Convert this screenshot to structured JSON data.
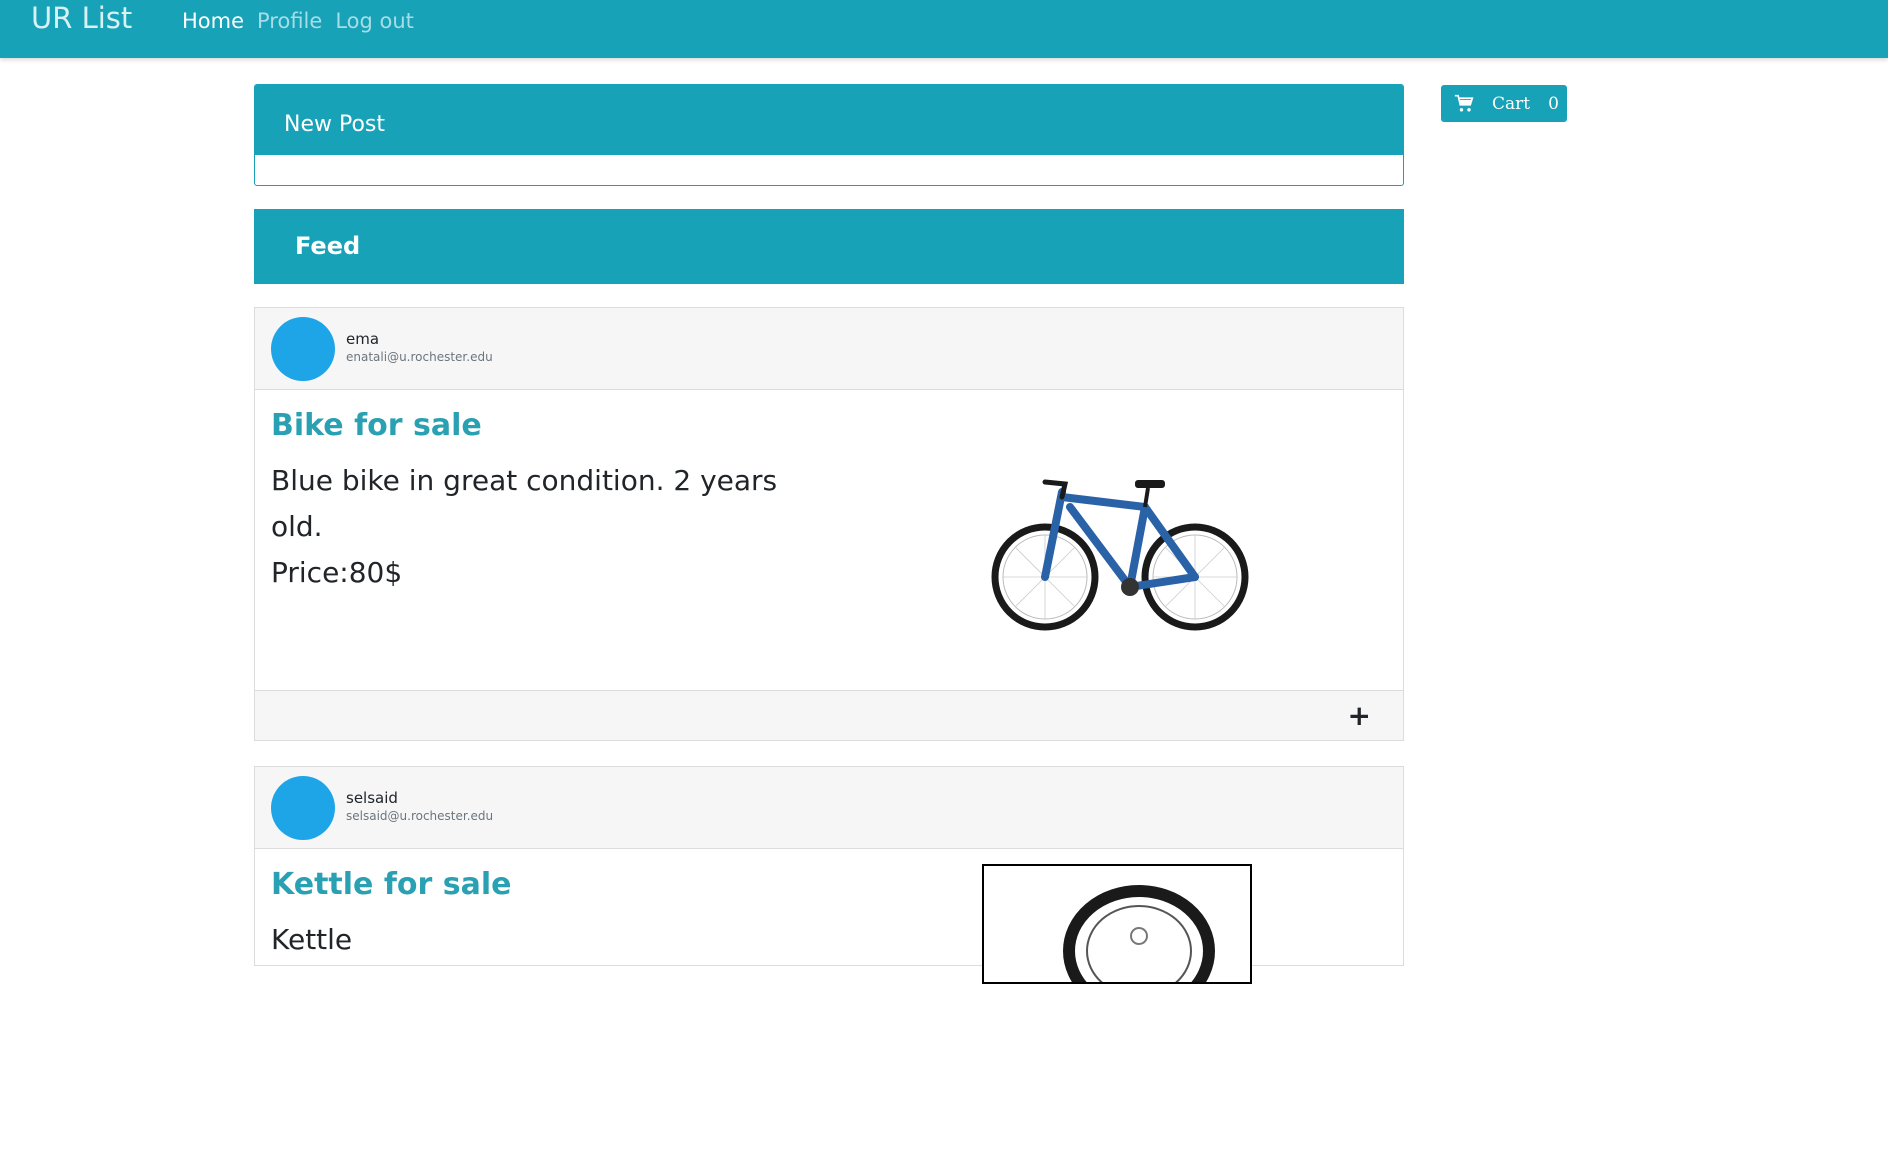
{
  "navbar": {
    "brand": "UR List",
    "links": [
      "Home",
      "Profile",
      "Log out"
    ]
  },
  "cart": {
    "label": "Cart",
    "count": "0"
  },
  "new_post": {
    "title": "New Post"
  },
  "feed": {
    "title": "Feed"
  },
  "posts": [
    {
      "username": "ema",
      "email": "enatali@u.rochester.edu",
      "title": "Bike for sale",
      "description": "Blue bike in great condition. 2 years old.",
      "price": "Price:80$",
      "image_icon": "bicycle",
      "action": "+"
    },
    {
      "username": "selsaid",
      "email": "selsaid@u.rochester.edu",
      "title": "Kettle for sale",
      "description": "Kettle",
      "image_icon": "kettle"
    }
  ],
  "colors": {
    "primary": "#17a2b8",
    "avatar": "#1ea5e8",
    "post_title": "#2aa1b3"
  }
}
